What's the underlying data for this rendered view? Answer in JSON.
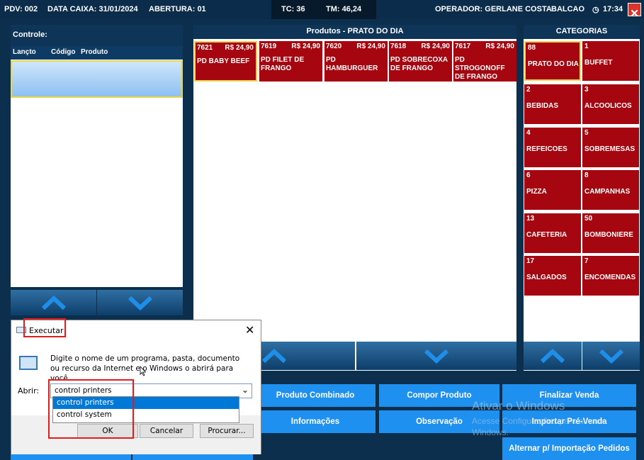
{
  "header": {
    "pdv": "PDV: 002",
    "data_caixa": "DATA CAIXA: 31/01/2024",
    "abertura": "ABERTURA: 01",
    "tc": "TC:  36",
    "tm": "TM: 46,24",
    "operador": "OPERADOR:  GERLANE COSTA",
    "balcao": "BALCAO",
    "clock": "17:34"
  },
  "controle": {
    "title": "Controle:",
    "columns": [
      "Lançto",
      "Código",
      "Produto"
    ]
  },
  "produtos": {
    "title": "Produtos - PRATO DO DIA",
    "items": [
      {
        "code": "7621",
        "price": "R$ 24,90",
        "name": "PD BABY BEEF"
      },
      {
        "code": "7619",
        "price": "R$ 24,90",
        "name": "PD FILET DE FRANGO"
      },
      {
        "code": "7620",
        "price": "R$ 24,90",
        "name": "PD HAMBURGUER"
      },
      {
        "code": "7618",
        "price": "R$ 24,90",
        "name": "PD SOBRECOXA DE FRANGO"
      },
      {
        "code": "7617",
        "price": "R$ 24,90",
        "name": "PD STROGONOFF DE FRANGO"
      }
    ]
  },
  "categorias": {
    "title": "CATEGORIAS",
    "items": [
      {
        "num": "88",
        "label": "PRATO DO DIA"
      },
      {
        "num": "1",
        "label": "BUFFET"
      },
      {
        "num": "2",
        "label": "BEBIDAS"
      },
      {
        "num": "3",
        "label": "ALCOOLICOS"
      },
      {
        "num": "4",
        "label": "REFEICOES"
      },
      {
        "num": "5",
        "label": "SOBREMESAS"
      },
      {
        "num": "6",
        "label": "PIZZA"
      },
      {
        "num": "8",
        "label": "CAMPANHAS"
      },
      {
        "num": "13",
        "label": "CAFETERIA"
      },
      {
        "num": "50",
        "label": "BOMBONIERE"
      },
      {
        "num": "17",
        "label": "SALGADOS"
      },
      {
        "num": "7",
        "label": "ENCOMENDAS"
      }
    ]
  },
  "actions": {
    "produto_combinado": "Produto Combinado",
    "compor_produto": "Compor Produto",
    "finalizar_venda": "Finalizar Venda",
    "informacoes": "Informações",
    "observacao": "Observação",
    "importar_pre_venda": "Importar Pré-Venda",
    "alternar": "Alternar p/ Importação Pedidos"
  },
  "watermark": {
    "title": "Ativar o Windows",
    "text": "Acesse Configurações para ativar o Windows."
  },
  "run_dialog": {
    "title": "Executar",
    "description": "Digite o nome de um programa, pasta, documento ou recurso da Internet e o Windows o abrirá para você.",
    "label": "Abrir:",
    "value": "control printers",
    "suggestions": [
      "control printers",
      "control system"
    ],
    "ok": "OK",
    "cancel": "Cancelar",
    "browse": "Procurar..."
  },
  "colors": {
    "product_red": "#a5060f",
    "button_blue": "#1e90f0",
    "selection_yellow": "#e9d64a",
    "highlight_blue": "#0078d7"
  }
}
